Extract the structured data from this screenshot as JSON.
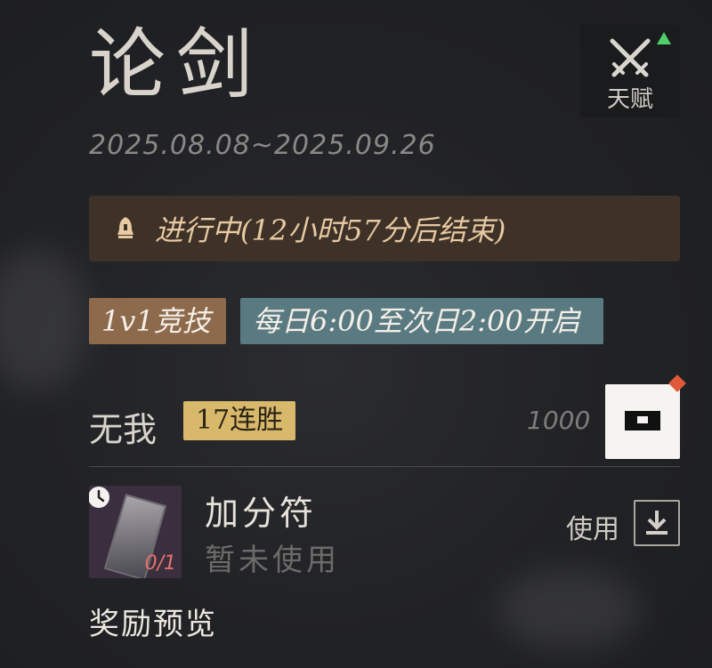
{
  "event": {
    "title": "论剑",
    "date_range": "2025.08.08~2025.09.26"
  },
  "talent_button": {
    "label": "天赋",
    "icon": "crossed-swords-icon",
    "badge_icon": "green-up-arrow-icon"
  },
  "status_banner": {
    "icon": "bell-icon",
    "text": "进行中(12小时57分后结束)"
  },
  "tags": {
    "mode": "1v1竞技",
    "schedule": "每日6:00至次日2:00开启"
  },
  "rank_row": {
    "rank_name": "无我",
    "streak": "17连胜",
    "score": "1000",
    "chest_icon": "treasure-chest-icon"
  },
  "item": {
    "name": "加分符",
    "status": "暂未使用",
    "count": "0/1",
    "use_label": "使用",
    "use_icon": "download-icon"
  },
  "reward_preview_label": "奖励预览",
  "colors": {
    "status_bg": "#3e3228",
    "status_text": "#e7c9a2",
    "mode_tag": "#8e6a4d",
    "schedule_tag": "#5a7a82",
    "streak_tag": "#d8b86a",
    "alert_dot": "#e05a3a",
    "talent_arrow": "#4fcf6a"
  }
}
